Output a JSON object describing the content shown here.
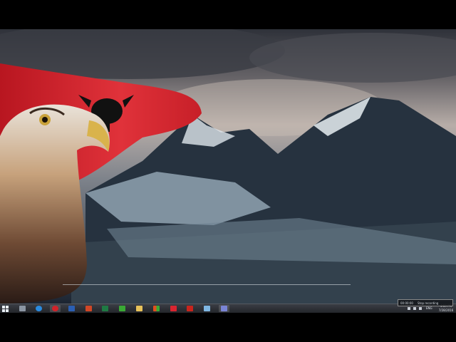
{
  "desktop": {
    "wallpaper": "eagle-with-albanian-flag-over-mountains",
    "colors": {
      "flag_red": "#d4202c",
      "eagle_black": "#111111",
      "sky": "#a9a2a0",
      "mountain": "#1e2a36"
    }
  },
  "taskbar": {
    "start": "windows-start-icon",
    "pinned": [
      {
        "name": "server-manager-icon",
        "color": "#8c96a3"
      },
      {
        "name": "internet-explorer-icon",
        "color": "#2a8be0"
      },
      {
        "name": "opera-icon",
        "color": "#d1232a"
      },
      {
        "name": "word-icon",
        "color": "#2b5fb3"
      },
      {
        "name": "powerpoint-icon",
        "color": "#d24726"
      },
      {
        "name": "excel-icon",
        "color": "#1f7a44"
      },
      {
        "name": "store-icon",
        "color": "#3aa935"
      },
      {
        "name": "file-explorer-icon",
        "color": "#e8c25a"
      },
      {
        "name": "office-icon",
        "color": "#e24f1f"
      },
      {
        "name": "app-14-icon",
        "color": "#d92530"
      },
      {
        "name": "acrobat-icon",
        "color": "#c9241c"
      },
      {
        "name": "remote-desktop-icon",
        "color": "#7fb7e3"
      },
      {
        "name": "powershell-icon",
        "color": "#7a85d6"
      }
    ],
    "tray": {
      "lang": "ENG",
      "time": "4:59 PM",
      "date": "7/28/2016"
    },
    "tooltip": {
      "left": "00:00:00",
      "right": "Stop recording"
    }
  }
}
